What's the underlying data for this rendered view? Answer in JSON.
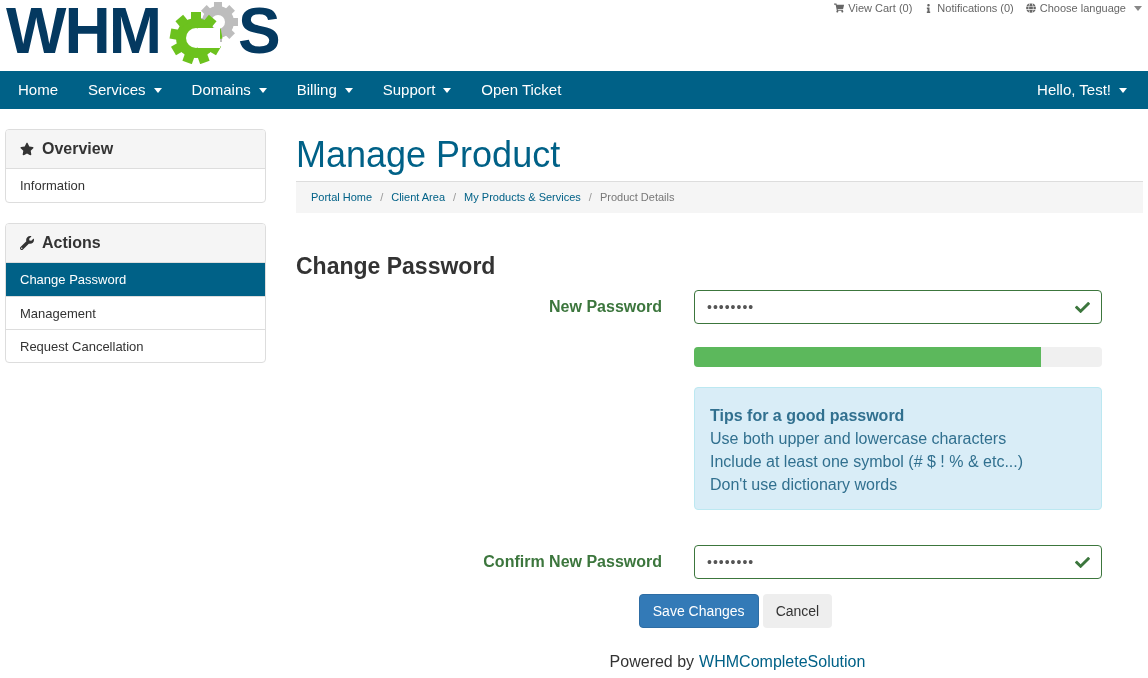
{
  "logo": {
    "before": "WHM",
    "after": "S"
  },
  "top_links": [
    {
      "kind": "cart",
      "label": "View Cart (0)",
      "dropdown": false
    },
    {
      "kind": "info",
      "label": "Notifications (0)",
      "dropdown": false
    },
    {
      "kind": "language",
      "label": "Choose language",
      "dropdown": true
    }
  ],
  "nav": {
    "items": [
      {
        "label": "Home",
        "dropdown": false
      },
      {
        "label": "Services",
        "dropdown": true
      },
      {
        "label": "Domains",
        "dropdown": true
      },
      {
        "label": "Billing",
        "dropdown": true
      },
      {
        "label": "Support",
        "dropdown": true
      },
      {
        "label": "Open Ticket",
        "dropdown": false
      }
    ],
    "user": {
      "label": "Hello, Test!",
      "dropdown": true
    }
  },
  "sidebar": [
    {
      "kind": "star",
      "title": "Overview",
      "items": [
        {
          "label": "Information",
          "selected": false
        }
      ]
    },
    {
      "kind": "wrench",
      "title": "Actions",
      "items": [
        {
          "label": "Change Password",
          "selected": true
        },
        {
          "label": "Management",
          "selected": false
        },
        {
          "label": "Request Cancellation",
          "selected": false
        }
      ]
    }
  ],
  "page_title": "Manage Product",
  "breadcrumb_separator": "/",
  "breadcrumb": [
    {
      "label": "Portal Home",
      "current": false
    },
    {
      "label": "Client Area",
      "current": false
    },
    {
      "label": "My Products & Services",
      "current": false
    },
    {
      "label": "Product Details",
      "current": true
    }
  ],
  "section_title": "Change Password",
  "new_password": {
    "label": "New Password",
    "value": "••••••••",
    "valid": true
  },
  "strength": {
    "level": 0.85
  },
  "tips": {
    "title": "Tips for a good password",
    "lines": [
      "Use both upper and lowercase characters",
      "Include at least one symbol (# $ ! % & etc...)",
      "Don't use dictionary words"
    ]
  },
  "confirm_password": {
    "label": "Confirm New Password",
    "value": "••••••••",
    "valid": true
  },
  "buttons": [
    {
      "label": "Save Changes",
      "kind": "primary"
    },
    {
      "label": "Cancel",
      "kind": "default"
    }
  ],
  "footer": {
    "text": "Powered by",
    "link": "WHMCompleteSolution"
  }
}
